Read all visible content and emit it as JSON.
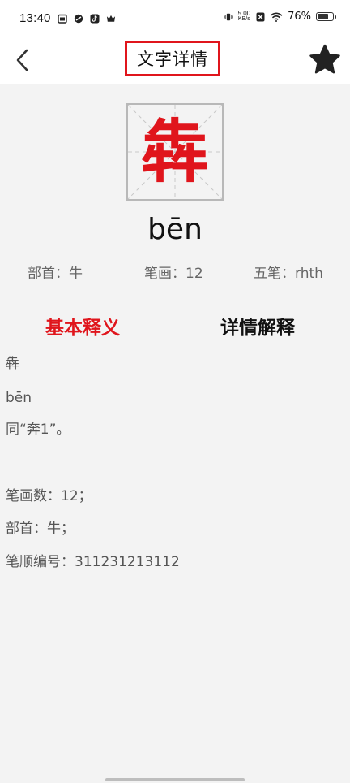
{
  "status_bar": {
    "time": "13:40",
    "net_speed_value": "5.00",
    "net_speed_unit": "KB/s",
    "battery_percent": "76%",
    "battery_level": 0.76
  },
  "header": {
    "title": "文字详情"
  },
  "character": {
    "glyph": "犇",
    "pinyin": "bēn",
    "radical": "部首：牛",
    "strokes": "笔画：12",
    "wubi": "五笔：rhth"
  },
  "tabs": [
    {
      "label": "基本释义",
      "active": true
    },
    {
      "label": "详情解释",
      "active": false
    }
  ],
  "content": {
    "lines": [
      "犇",
      "bēn",
      "同“奔1”。",
      "",
      "笔画数：12；",
      "部首：牛；",
      "笔顺编号：311231213112"
    ]
  },
  "colors": {
    "accent_red": "#e0151c",
    "background": "#f3f3f3",
    "header_bg": "#ffffff"
  }
}
